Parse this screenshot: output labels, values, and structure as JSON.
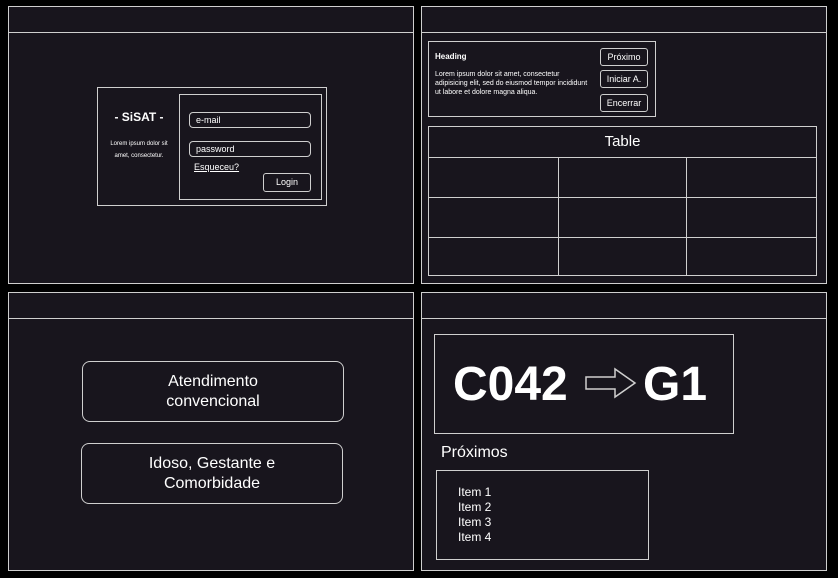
{
  "login": {
    "brand": "- SiSAT -",
    "description": "Lorem ipsum dolor sit amet, consectetur.",
    "email_value": "e-mail",
    "password_value": "password",
    "forgot_label": "Esqueceu?",
    "login_label": "Login"
  },
  "control": {
    "heading": "Heading",
    "text": "Lorem ipsum dolor sit amet, consectetur adipisicing elit, sed do eiusmod tempor incididunt ut labore et dolore magna aliqua.",
    "buttons": [
      "Próximo",
      "Iniciar A.",
      "Encerrar"
    ]
  },
  "table": {
    "title": "Table",
    "rows": [
      [
        "",
        "",
        ""
      ],
      [
        "",
        "",
        ""
      ],
      [
        "",
        "",
        ""
      ]
    ]
  },
  "choice": {
    "option1": "Atendimento\nconvencional",
    "option2": "Idoso, Gestante e\nComorbidade"
  },
  "display": {
    "ticket": "C042",
    "counter": "G1",
    "arrow_icon": "right-arrow-icon",
    "next_title": "Próximos",
    "next_items": [
      "Item 1",
      "Item 2",
      "Item 3",
      "Item 4"
    ]
  },
  "colors": {
    "background": "#000000",
    "panel": "#18151d",
    "border": "#cfcfcf",
    "text": "#ffffff"
  }
}
